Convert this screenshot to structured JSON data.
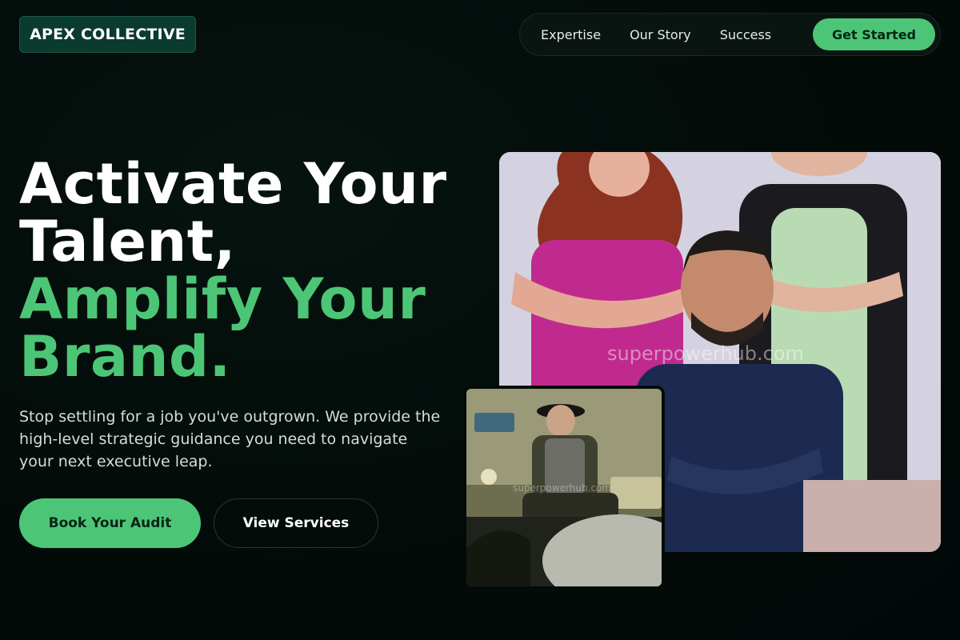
{
  "brand": {
    "name": "APEX COLLECTIVE"
  },
  "nav": {
    "links": [
      "Expertise",
      "Our Story",
      "Success"
    ],
    "cta": "Get Started"
  },
  "hero": {
    "headline_lines": [
      "Activate Your",
      "Talent,"
    ],
    "headline_accent_lines": [
      "Amplify Your",
      "Brand."
    ],
    "subtext": "Stop settling for a job you've outgrown. We provide the high-level strategic guidance you need to navigate your next executive leap.",
    "primary_button": "Book Your Audit",
    "secondary_button": "View Services"
  },
  "images": {
    "main_watermark": "superpowerhub.com",
    "small_watermark": "superpowerhub.com"
  },
  "colors": {
    "accent": "#4cc676",
    "background": "#030b09",
    "logo_bg": "#0b3a2f"
  }
}
